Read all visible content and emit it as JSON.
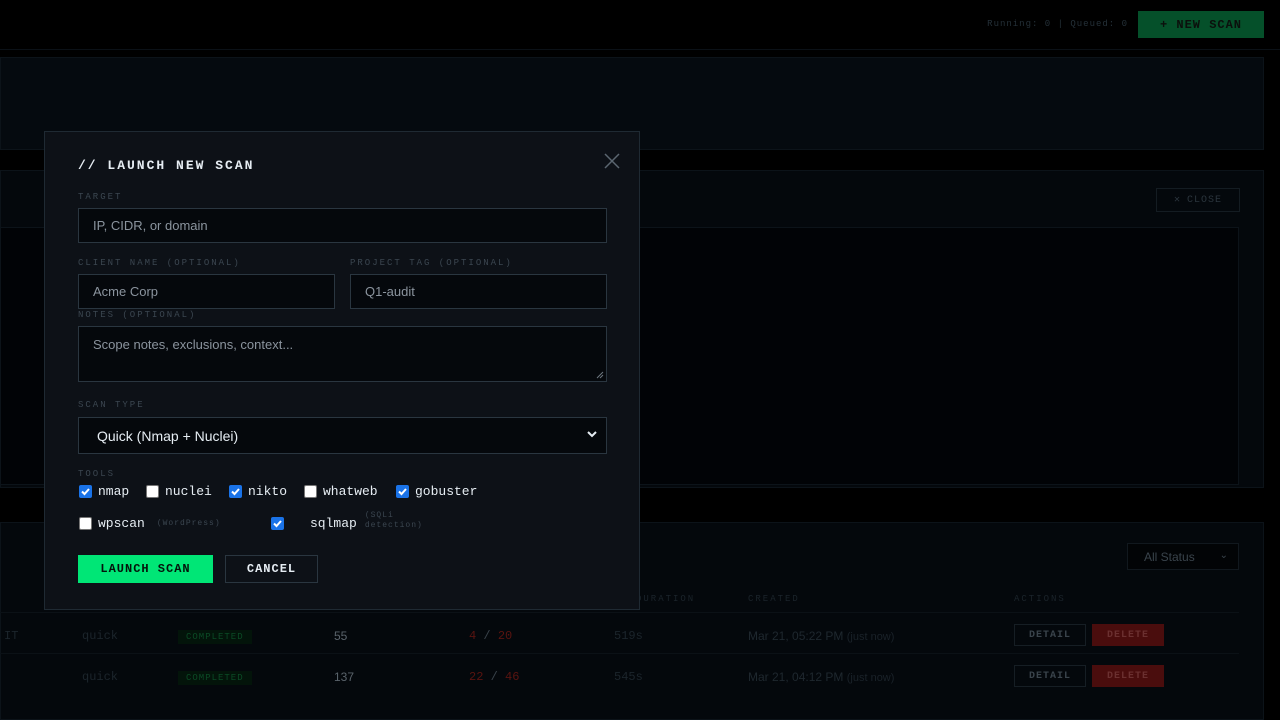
{
  "header": {
    "run_stats": "Running: 0 | Queued: 0",
    "new_scan_label": "+ NEW SCAN"
  },
  "output_panel": {
    "close_label": "CLOSE"
  },
  "scans_table": {
    "status_filter": "All Status",
    "columns": {
      "duration": "DURATION",
      "created": "CREATED",
      "actions": "ACTIONS"
    },
    "rows": [
      {
        "target_tail": "IT",
        "type": "quick",
        "status": "COMPLETED",
        "count": "55",
        "sev_a": "4",
        "sev_sep": "/",
        "sev_b": "20",
        "duration": "519s",
        "created": "Mar 21, 05:22 PM",
        "created_note": "(just now)",
        "detail": "DETAIL",
        "delete": "DELETE"
      },
      {
        "target_tail": "",
        "type": "quick",
        "status": "COMPLETED",
        "count": "137",
        "sev_a": "22",
        "sev_sep": "/",
        "sev_b": "46",
        "duration": "545s",
        "created": "Mar 21, 04:12 PM",
        "created_note": "(just now)",
        "detail": "DETAIL",
        "delete": "DELETE"
      }
    ]
  },
  "modal": {
    "title": "// LAUNCH NEW SCAN",
    "target_label": "TARGET",
    "target_placeholder": "IP, CIDR, or domain",
    "client_label": "CLIENT NAME (OPTIONAL)",
    "client_placeholder": "Acme Corp",
    "project_label": "PROJECT TAG (OPTIONAL)",
    "project_placeholder": "Q1-audit",
    "notes_label": "NOTES (OPTIONAL)",
    "notes_placeholder": "Scope notes, exclusions, context...",
    "scan_type_label": "SCAN TYPE",
    "scan_type_value": "Quick (Nmap + Nuclei)",
    "tools_label": "TOOLS",
    "tools": [
      {
        "name": "nmap",
        "checked": true
      },
      {
        "name": "nuclei",
        "checked": false
      },
      {
        "name": "nikto",
        "checked": true
      },
      {
        "name": "whatweb",
        "checked": false
      },
      {
        "name": "gobuster",
        "checked": true
      },
      {
        "name": "wpscan",
        "checked": false,
        "hint": "(WordPress)"
      },
      {
        "name": "sqlmap",
        "checked": true,
        "hint_line1": "(SQLi",
        "hint_line2": "detection)"
      }
    ],
    "launch_label": "LAUNCH SCAN",
    "cancel_label": "CANCEL"
  },
  "colors": {
    "accent_green": "#00e676",
    "checkbox_blue": "#1a73e8",
    "danger_red": "#4a0d0d"
  }
}
